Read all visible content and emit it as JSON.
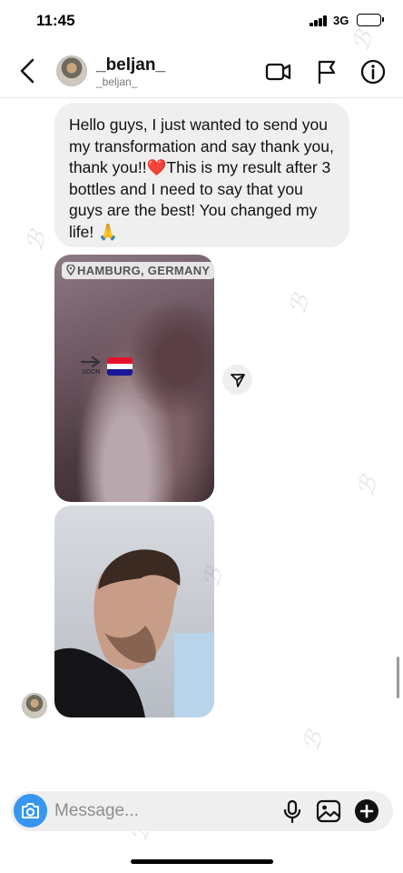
{
  "status_bar": {
    "time": "11:45",
    "network": "3G",
    "battery_level": 1.0
  },
  "header": {
    "username": "_beljan_",
    "handle": "_beljan_",
    "icons": [
      "back-arrow-icon",
      "video-camera-icon",
      "flag-icon",
      "info-icon"
    ]
  },
  "messages": {
    "text": "Hello guys, I just wanted to send you my transformation and say thank you, thank you!!❤️This is my result after 3 bottles and I need to say that you guys are the best! You changed my life! 🙏",
    "photo_1": {
      "location_tag": "HAMBURG, GERMANY",
      "sticker_label": "SOON",
      "flag_colors": [
        "#e8112d",
        "#ffffff",
        "#171796"
      ]
    },
    "photo_2": {}
  },
  "composer": {
    "placeholder": "Message...",
    "icons": [
      "camera-icon",
      "microphone-icon",
      "image-icon",
      "plus-icon"
    ]
  },
  "colors": {
    "accent_blue": "#3797f0",
    "bubble_gray": "#efefef"
  }
}
